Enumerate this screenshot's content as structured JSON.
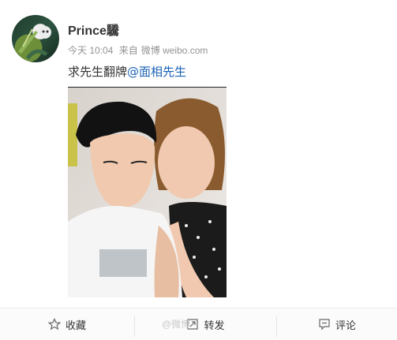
{
  "post": {
    "username": "Prince驣",
    "time": "今天 10:04",
    "source_prefix": "来自",
    "source": "微博 weibo.com",
    "text": "求先生翻牌",
    "mention": "@面相先生"
  },
  "actions": {
    "favorite_label": "收藏",
    "repost_label": "转发",
    "comment_label": "评论"
  },
  "watermark": "@微博",
  "colors": {
    "link": "#1b63b5",
    "meta": "#939393"
  }
}
